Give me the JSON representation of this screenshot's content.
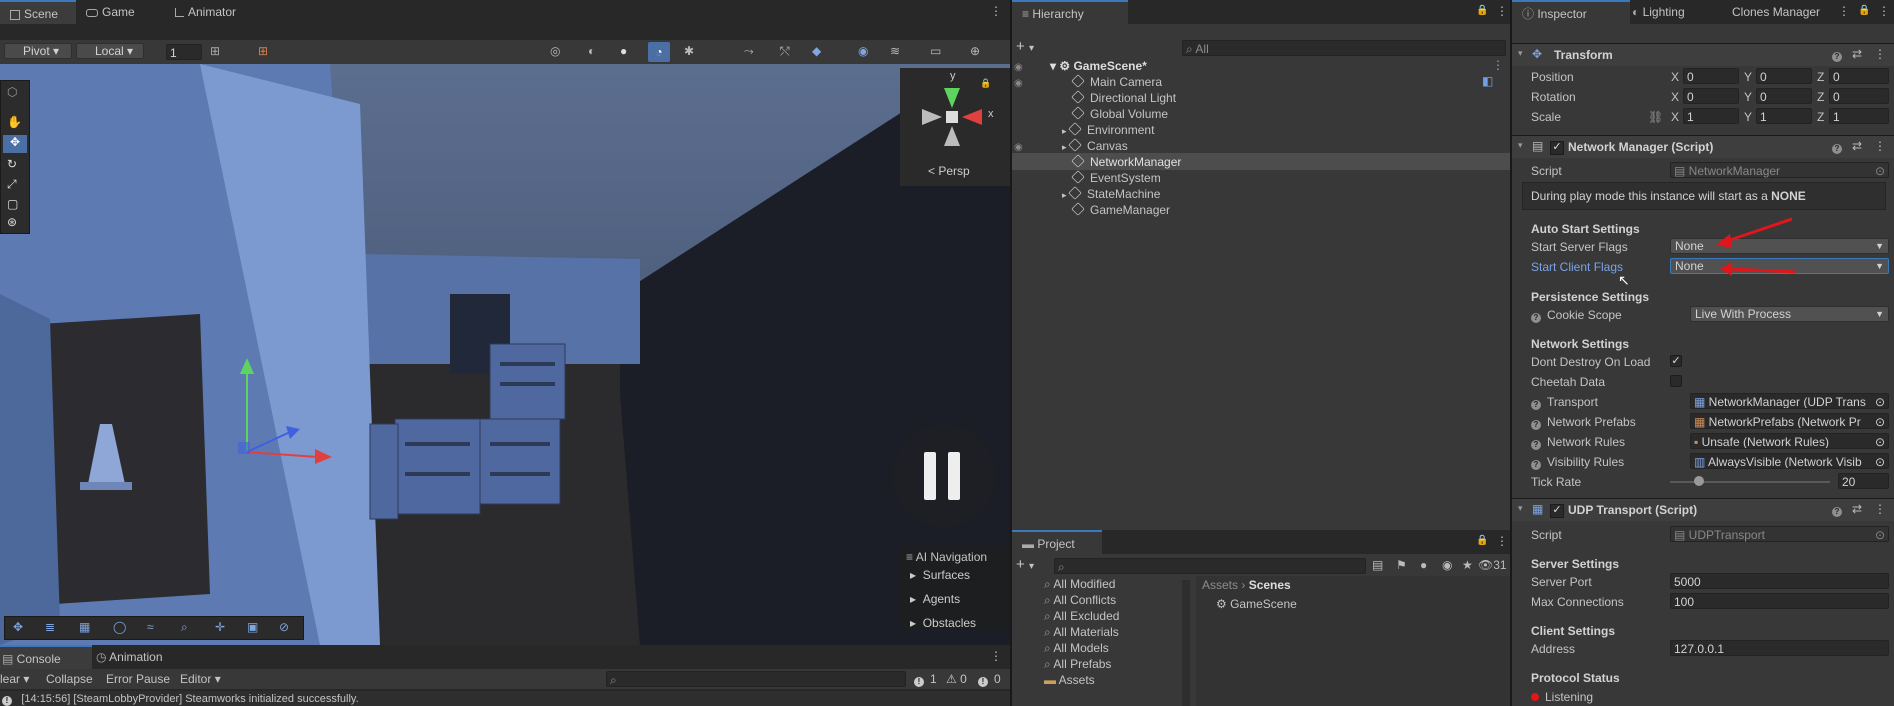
{
  "scene_tabs": {
    "scene": "Scene",
    "game": "Game",
    "animator": "Animator"
  },
  "scene_toolbar": {
    "pivot": "Pivot",
    "local": "Local",
    "grid_value": "1"
  },
  "gizmo": {
    "y": "y",
    "x": "x",
    "persp": "Persp"
  },
  "ai_nav": {
    "title": "AI Navigation",
    "items": [
      "Surfaces",
      "Agents",
      "Obstacles"
    ]
  },
  "console_tabs": {
    "console": "Console",
    "animation": "Animation"
  },
  "console_toolbar": {
    "clear": "lear",
    "collapse": "Collapse",
    "error_pause": "Error Pause",
    "editor": "Editor",
    "count_log": "1",
    "count_warn": "0",
    "count_err": "0"
  },
  "console_line": "[14:15:56] [SteamLobbyProvider] Steamworks initialized successfully.",
  "hierarchy": {
    "tab": "Hierarchy",
    "search_placeholder": "All",
    "scene": "GameScene*",
    "items": [
      "Main Camera",
      "Directional Light",
      "Global Volume",
      "Environment",
      "Canvas",
      "NetworkManager",
      "EventSystem",
      "StateMachine",
      "GameManager"
    ]
  },
  "project": {
    "tab": "Project",
    "count": "31",
    "favorites": [
      "All Modified",
      "All Conflicts",
      "All Excluded",
      "All Materials",
      "All Models",
      "All Prefabs",
      "Assets"
    ],
    "breadcrumb_root": "Assets",
    "breadcrumb_current": "Scenes",
    "files": [
      "GameScene"
    ]
  },
  "inspector": {
    "tabs": {
      "inspector": "Inspector",
      "lighting": "Lighting",
      "clones": "Clones Manager"
    },
    "transform": {
      "title": "Transform",
      "position": {
        "label": "Position",
        "x": "0",
        "y": "0",
        "z": "0"
      },
      "rotation": {
        "label": "Rotation",
        "x": "0",
        "y": "0",
        "z": "0"
      },
      "scale": {
        "label": "Scale",
        "x": "1",
        "y": "1",
        "z": "1"
      },
      "axes": {
        "x": "X",
        "y": "Y",
        "z": "Z"
      }
    },
    "network_manager": {
      "title": "Network Manager (Script)",
      "script_label": "Script",
      "script_value": "NetworkManager",
      "play_note": "During play mode this instance will start as a",
      "play_mode": "NONE",
      "auto_start_header": "Auto Start Settings",
      "server_flags_label": "Start Server Flags",
      "server_flags_value": "None",
      "client_flags_label": "Start Client Flags",
      "client_flags_value": "None",
      "persistence_header": "Persistence Settings",
      "cookie_label": "Cookie Scope",
      "cookie_value": "Live With Process",
      "network_header": "Network Settings",
      "dont_destroy_label": "Dont Destroy On Load",
      "cheetah_label": "Cheetah Data",
      "transport_label": "Transport",
      "transport_value": "NetworkManager (UDP Trans",
      "prefabs_label": "Network Prefabs",
      "prefabs_value": "NetworkPrefabs (Network Pr",
      "rules_label": "Network Rules",
      "rules_value": "Unsafe (Network Rules)",
      "visibility_label": "Visibility Rules",
      "visibility_value": "AlwaysVisible (Network Visib",
      "tick_label": "Tick Rate",
      "tick_value": "20"
    },
    "udp_transport": {
      "title": "UDP Transport (Script)",
      "script_label": "Script",
      "script_value": "UDPTransport",
      "server_header": "Server Settings",
      "port_label": "Server Port",
      "port_value": "5000",
      "maxconn_label": "Max Connections",
      "maxconn_value": "100",
      "client_header": "Client Settings",
      "address_label": "Address",
      "address_value": "127.0.0.1",
      "protocol_header": "Protocol Status",
      "status": "Listening"
    }
  },
  "colors": {
    "accent": "#3a79bb",
    "annotation_arrow": "#e0161b",
    "panel_bg": "#383838",
    "scene_sky": "#3b4a66"
  }
}
